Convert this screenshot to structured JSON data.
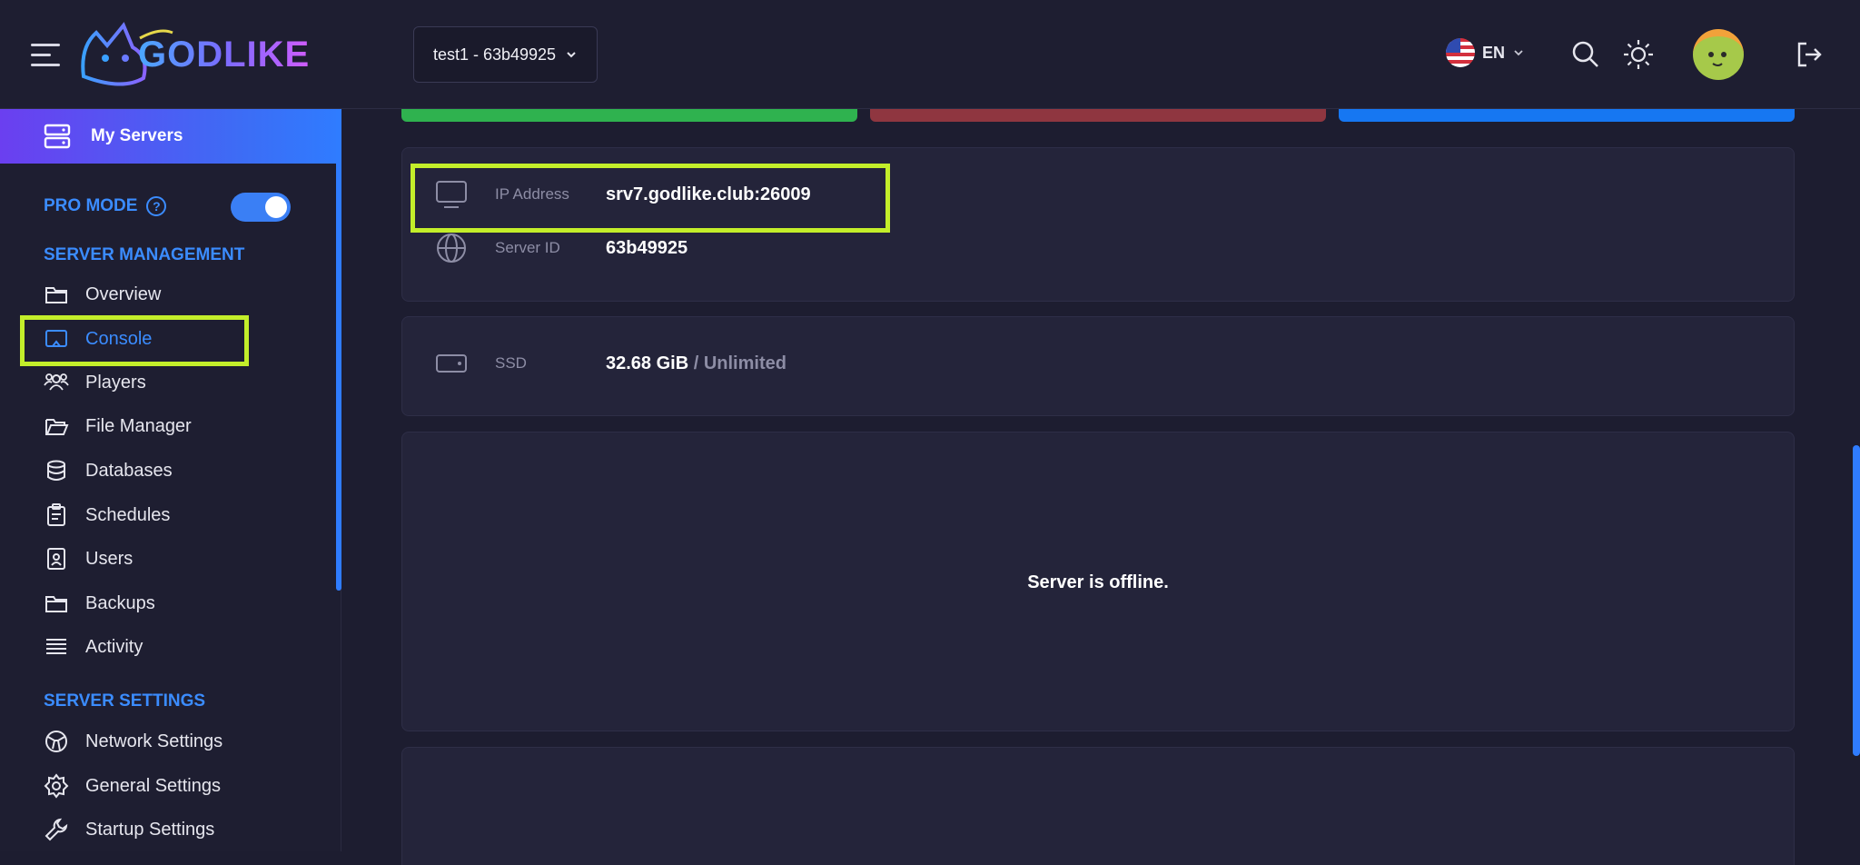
{
  "header": {
    "logo_text": "GODLIKE",
    "server_select": "test1 - 63b49925",
    "language": "EN"
  },
  "sidebar": {
    "my_servers": "My Servers",
    "pro_mode": "PRO MODE",
    "pro_mode_help": "?",
    "server_management_title": "SERVER MANAGEMENT",
    "management_items": [
      {
        "label": "Overview",
        "icon": "folder-icon"
      },
      {
        "label": "Console",
        "icon": "console-icon"
      },
      {
        "label": "Players",
        "icon": "players-icon"
      },
      {
        "label": "File Manager",
        "icon": "folder-open-icon"
      },
      {
        "label": "Databases",
        "icon": "database-icon"
      },
      {
        "label": "Schedules",
        "icon": "clipboard-icon"
      },
      {
        "label": "Users",
        "icon": "user-badge-icon"
      },
      {
        "label": "Backups",
        "icon": "folder-icon"
      },
      {
        "label": "Activity",
        "icon": "list-icon"
      }
    ],
    "server_settings_title": "SERVER SETTINGS",
    "settings_items": [
      {
        "label": "Network Settings",
        "icon": "network-icon"
      },
      {
        "label": "General Settings",
        "icon": "gear-icon"
      },
      {
        "label": "Startup Settings",
        "icon": "wrench-icon"
      }
    ]
  },
  "server_info": {
    "ip_label": "IP Address",
    "ip_value": "srv7.godlike.club:26009",
    "id_label": "Server ID",
    "id_value": "63b49925"
  },
  "storage": {
    "label": "SSD",
    "used": "32.68 GiB",
    "separator": " / ",
    "limit": "Unlimited"
  },
  "status": {
    "message": "Server is offline."
  },
  "colors": {
    "accent": "#3b8cff",
    "highlight": "#c3ee2a",
    "start": "#2fb24f",
    "stop": "#8f3640",
    "restart": "#1677f2"
  }
}
